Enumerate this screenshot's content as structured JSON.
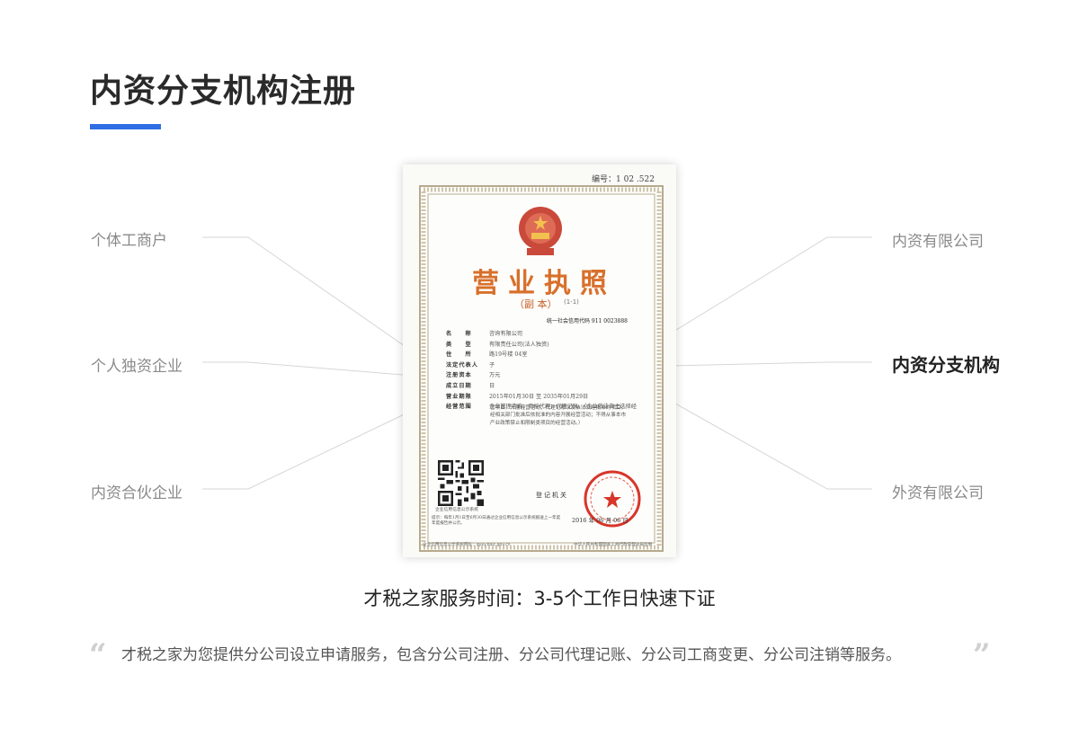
{
  "page": {
    "title": "内资分支机构注册",
    "accent_color": "#2f6ee5"
  },
  "categories": {
    "left": [
      "个体工商户",
      "个人独资企业",
      "内资合伙企业"
    ],
    "right": [
      "内资有限公司",
      "内资分支机构",
      "外资有限公司"
    ],
    "active": "内资分支机构"
  },
  "certificate": {
    "number": "编号：1 02    .522",
    "heading": "营业执照",
    "copy_label": "（副 本）",
    "copy_sub": "(1-1)",
    "credit_code": "统一社会信用代码 911          0023888",
    "fields": [
      {
        "label": "名　　称",
        "value": "            咨询有限公司"
      },
      {
        "label": "类　　型",
        "value": "有限责任公司(法人独资)"
      },
      {
        "label": "住　　所",
        "value": "                   路19号楼          04室"
      },
      {
        "label": "法定代表人",
        "value": "    子"
      },
      {
        "label": "注册资本",
        "value": "     万元"
      },
      {
        "label": "成立日期",
        "value": "          日"
      },
      {
        "label": "营业期限",
        "value": "2015年01月30日 至 2035年01月29日"
      },
      {
        "label": "经营范围",
        "value": "企业管理咨询；商标代理；代理记账。（企业依法自主选择经"
      }
    ],
    "scope_lines": [
      "营项目，开展经营活动；代理记账以及依法须经批准的项目，",
      "经相关部门批准后依批准的内容开展经营活动；不得从事本市",
      "产业政策禁止和限制类项目的经营活动。）"
    ],
    "qr_caption": "企业信用信息公示系统",
    "authority": "登记机关",
    "issue_date": "2016  年  06 月 06 日",
    "note": "提示：每年1月1日至6月30日通过企业信用信息公示系统报送上一年度年度报告并公示。",
    "footer_left": "企业信用信息公示系统网址：qyxy.baic.gov.cn",
    "footer_right": "中华人民共和国国家工商行政管理总局监制"
  },
  "service_time": "才税之家服务时间：3-5个工作日快速下证",
  "description": {
    "open_quote": "“",
    "text": "才税之家为您提供分公司设立申请服务，包含分公司注册、分公司代理记账、分公司工商变更、分公司注销等服务。",
    "close_quote": "”"
  }
}
